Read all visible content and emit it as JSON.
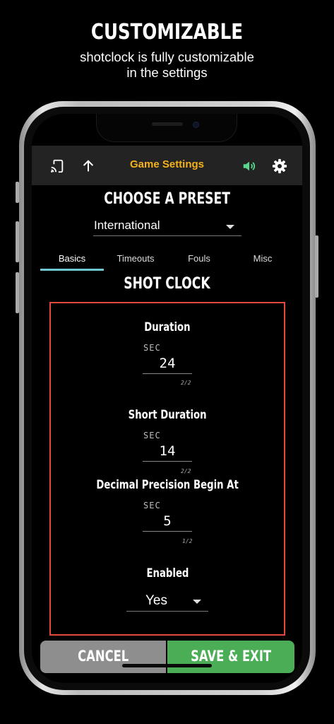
{
  "promo": {
    "title": "CUSTOMIZABLE",
    "subtitle_line1": "shotclock is fully customizable",
    "subtitle_line2": "in the settings"
  },
  "app_bar": {
    "title": "Game Settings",
    "icons": [
      "cast-icon",
      "upload-arrow-icon",
      "volume-icon",
      "gear-icon"
    ],
    "title_color": "#f3b21c",
    "volume_color": "#58d68d"
  },
  "preset": {
    "label": "CHOOSE A PRESET",
    "selected": "International"
  },
  "tabs": [
    {
      "label": "Basics",
      "active": true
    },
    {
      "label": "Timeouts",
      "active": false
    },
    {
      "label": "Fouls",
      "active": false
    },
    {
      "label": "Misc",
      "active": false
    }
  ],
  "section": {
    "title": "SHOT CLOCK"
  },
  "fields": {
    "duration": {
      "label": "Duration",
      "unit": "SEC",
      "value": "24",
      "counter": "2/2"
    },
    "short_duration": {
      "label": "Short Duration",
      "unit": "SEC",
      "value": "14",
      "counter": "2/2"
    },
    "decimal_precision": {
      "label": "Decimal Precision Begin At",
      "unit": "SEC",
      "value": "5",
      "counter": "1/2"
    },
    "enabled": {
      "label": "Enabled",
      "value": "Yes"
    }
  },
  "actions": {
    "cancel_label": "CANCEL",
    "save_label": "SAVE & EXIT"
  },
  "colors": {
    "accent_tab": "#6fc7d6",
    "box_border": "#e24a3e",
    "save_green": "#4bad55",
    "cancel_gray": "#8e8e8e"
  }
}
